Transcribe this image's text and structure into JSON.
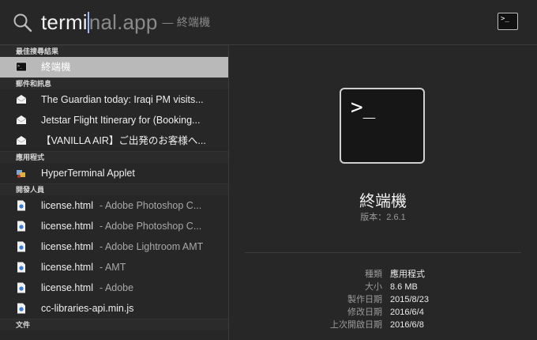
{
  "search": {
    "typed": "termi",
    "completion": "nal.app",
    "hint": "— 終端機"
  },
  "sections": {
    "top_hit": "最佳搜尋結果",
    "mail": "郵件和訊息",
    "apps": "應用程式",
    "developer": "開發人員",
    "documents": "文件"
  },
  "top_hit": {
    "label": "終端機",
    "icon": "terminal-icon"
  },
  "mail_items": [
    {
      "label": "The Guardian today: Iraqi PM visits...",
      "icon": "envelope-icon"
    },
    {
      "label": "Jetstar Flight Itinerary for (Booking...",
      "icon": "envelope-icon"
    },
    {
      "label": "【VANILLA AIR】ご出発のお客様へ...",
      "icon": "envelope-icon"
    }
  ],
  "app_items": [
    {
      "label": "HyperTerminal Applet",
      "icon": "applet-icon"
    }
  ],
  "dev_items": [
    {
      "label": "license.html",
      "sub": "- Adobe Photoshop C...",
      "icon": "html-file-icon"
    },
    {
      "label": "license.html",
      "sub": "- Adobe Photoshop C...",
      "icon": "html-file-icon"
    },
    {
      "label": "license.html",
      "sub": "- Adobe Lightroom AMT",
      "icon": "html-file-icon"
    },
    {
      "label": "license.html",
      "sub": "- AMT",
      "icon": "html-file-icon"
    },
    {
      "label": "license.html",
      "sub": "- Adobe",
      "icon": "html-file-icon"
    },
    {
      "label": "cc-libraries-api.min.js",
      "sub": "",
      "icon": "js-file-icon"
    }
  ],
  "preview": {
    "prompt": ">_",
    "name": "終端機",
    "version": "版本：2.6.1",
    "meta": [
      {
        "key": "種類",
        "value": "應用程式"
      },
      {
        "key": "大小",
        "value": "8.6 MB"
      },
      {
        "key": "製作日期",
        "value": "2015/8/23"
      },
      {
        "key": "修改日期",
        "value": "2016/6/4"
      },
      {
        "key": "上次開啟日期",
        "value": "2016/6/8"
      }
    ]
  },
  "colors": {
    "background": "#272727",
    "selection": "#b9b9b9",
    "caret": "#9fb7ff"
  }
}
